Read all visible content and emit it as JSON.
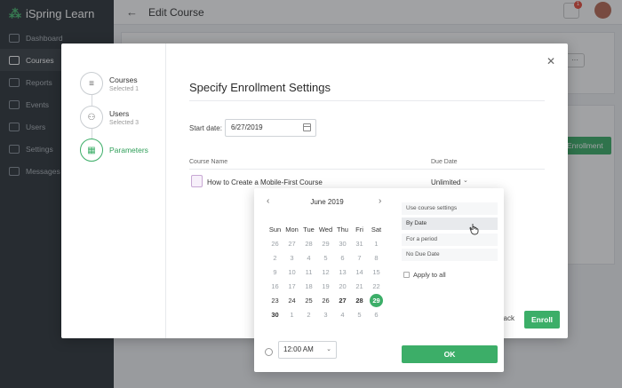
{
  "app": {
    "logo": "iSpring Learn",
    "page_title": "Edit Course",
    "notification_count": "1"
  },
  "sidebar": {
    "items": [
      {
        "label": "Dashboard",
        "active": false
      },
      {
        "label": "Courses",
        "active": true
      },
      {
        "label": "Reports",
        "active": false
      },
      {
        "label": "Events",
        "active": false
      },
      {
        "label": "Users",
        "active": false
      },
      {
        "label": "Settings",
        "active": false
      },
      {
        "label": "Messages",
        "active": false
      }
    ]
  },
  "background": {
    "enroll_label": "Enrollment",
    "more_label": "···"
  },
  "modal": {
    "steps": [
      {
        "name": "Courses",
        "sub": "Selected 1",
        "icon": "document-icon"
      },
      {
        "name": "Users",
        "sub": "Selected 3",
        "icon": "users-icon"
      },
      {
        "name": "Parameters",
        "sub": "",
        "icon": "calendar-icon"
      }
    ],
    "title": "Specify Enrollment Settings",
    "start_label": "Start date:",
    "start_value": "6/27/2019",
    "col_course": "Course Name",
    "col_due": "Due Date",
    "course_name": "How to Create a Mobile-First Course",
    "due_value": "Unlimited",
    "back_label": "Back",
    "enroll_label": "Enroll"
  },
  "picker": {
    "month": "June 2019",
    "weekdays": [
      "Sun",
      "Mon",
      "Tue",
      "Wed",
      "Thu",
      "Fri",
      "Sat"
    ],
    "weeks": [
      [
        "26",
        "27",
        "28",
        "29",
        "30",
        "31",
        "1"
      ],
      [
        "2",
        "3",
        "4",
        "5",
        "6",
        "7",
        "8"
      ],
      [
        "9",
        "10",
        "11",
        "12",
        "13",
        "14",
        "15"
      ],
      [
        "16",
        "17",
        "18",
        "19",
        "20",
        "21",
        "22"
      ],
      [
        "23",
        "24",
        "25",
        "26",
        "27",
        "28",
        "29"
      ],
      [
        "30",
        "1",
        "2",
        "3",
        "4",
        "5",
        "6"
      ]
    ],
    "selected_day": "29",
    "time_value": "12:00 AM",
    "options": [
      "Use course settings",
      "By Date",
      "For a period",
      "No Due Date"
    ],
    "hovered_option": "By Date",
    "apply_label": "Apply to all",
    "ok_label": "OK",
    "accent_color": "#3cae68"
  }
}
